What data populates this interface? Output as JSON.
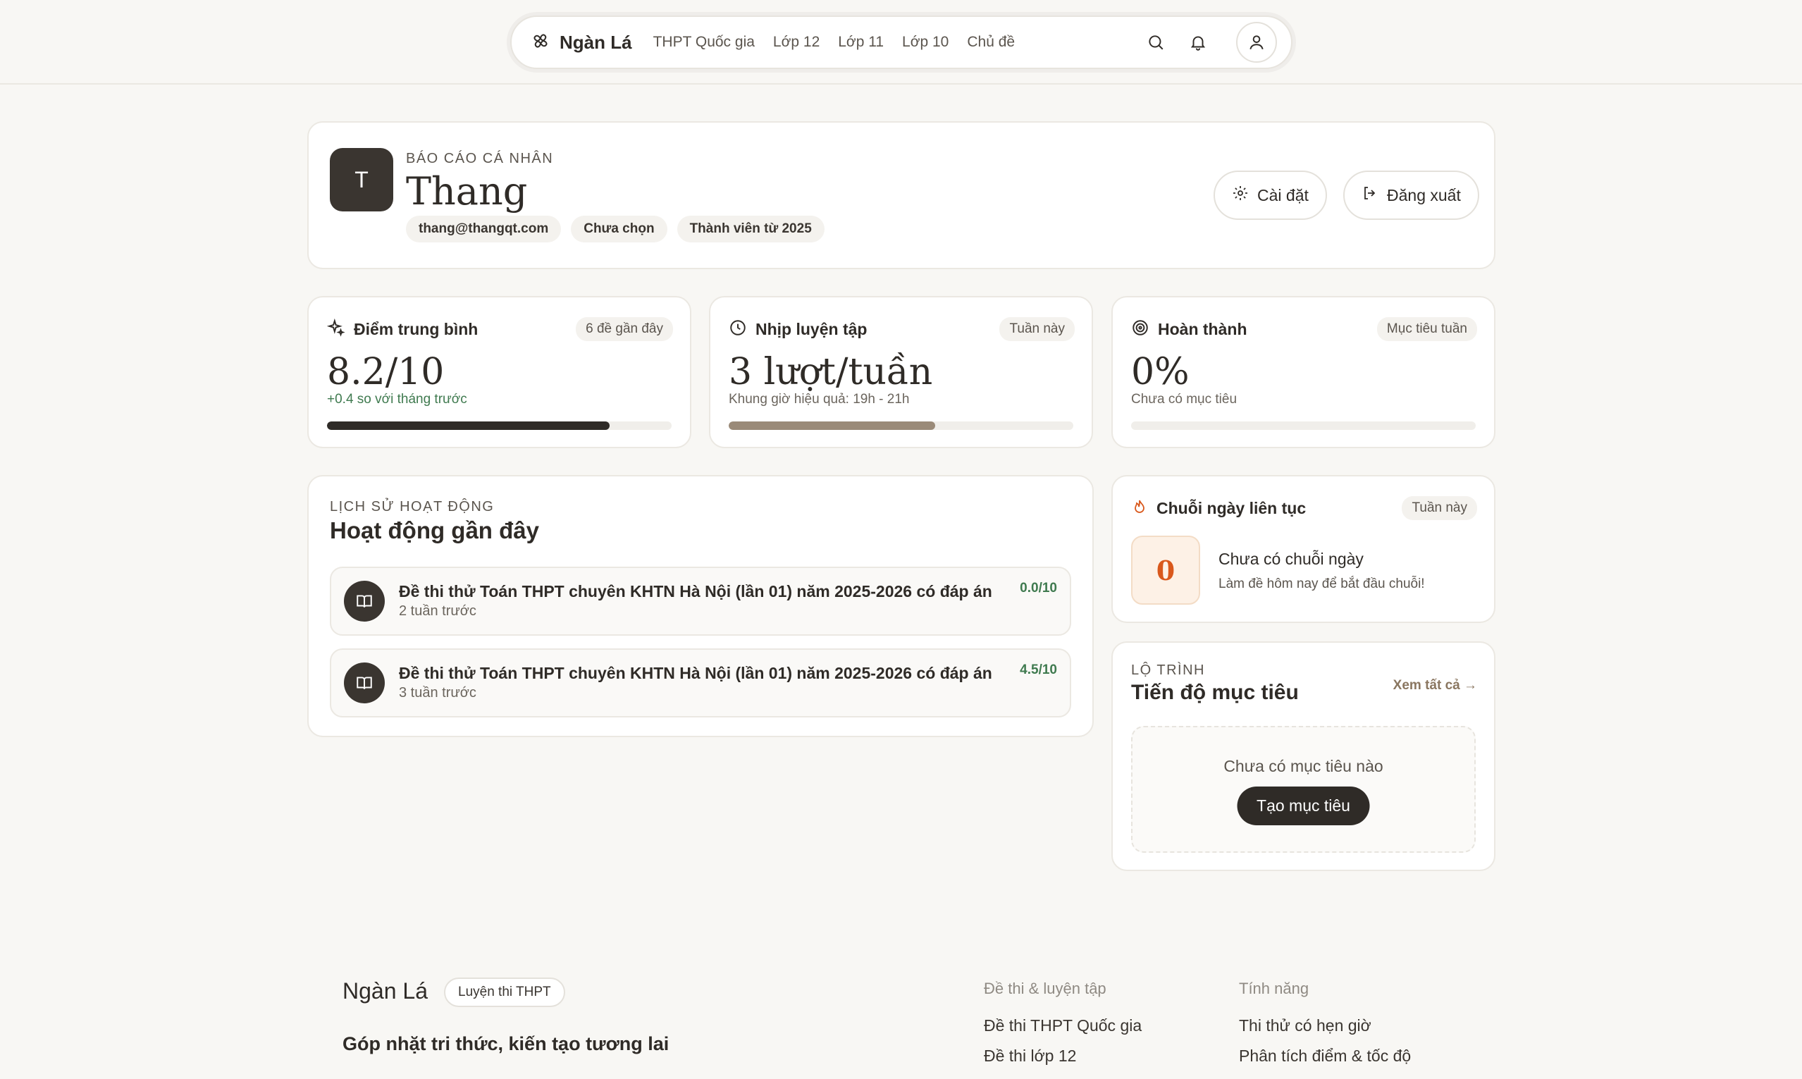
{
  "nav": {
    "brand": "Ngàn Lá",
    "links": [
      "THPT Quốc gia",
      "Lớp 12",
      "Lớp 11",
      "Lớp 10",
      "Chủ đề"
    ],
    "icons": [
      "search-icon",
      "bell-icon",
      "user-icon"
    ]
  },
  "profile": {
    "eyebrow": "BÁO CÁO CÁ NHÂN",
    "initial": "T",
    "name": "Thang",
    "chips": [
      "thang@thangqt.com",
      "Chưa chọn",
      "Thành viên từ 2025"
    ],
    "settings_label": "Cài đặt",
    "logout_label": "Đăng xuất"
  },
  "stats": [
    {
      "title": "Điểm trung bình",
      "badge": "6 đề gần đây",
      "value": "8.2/10",
      "sub": "+0.4 so với tháng trước",
      "progress": 0.82,
      "bar_color": "#2f2b27",
      "icon": "sparkle-icon"
    },
    {
      "title": "Nhịp luyện tập",
      "badge": "Tuần này",
      "value": "3 lượt/tuần",
      "sub": "Khung giờ hiệu quả: 19h - 21h",
      "progress": 0.6,
      "bar_color": "#9a8a78",
      "icon": "clock-icon"
    },
    {
      "title": "Hoàn thành",
      "badge": "Mục tiêu tuần",
      "value": "0%",
      "sub": "Chưa có mục tiêu",
      "progress": 0,
      "bar_color": "#2f2b27",
      "icon": "target-icon"
    }
  ],
  "history": {
    "eyebrow": "LỊCH SỬ HOẠT ĐỘNG",
    "title": "Hoạt động gần đây",
    "items": [
      {
        "title": "Đề thi thử Toán THPT chuyên KHTN Hà Nội (lần 01) năm 2025-2026 có đáp án",
        "time": "2 tuần trước",
        "score": "0.0/10"
      },
      {
        "title": "Đề thi thử Toán THPT chuyên KHTN Hà Nội (lần 01) năm 2025-2026 có đáp án",
        "time": "3 tuần trước",
        "score": "4.5/10"
      }
    ]
  },
  "streak": {
    "title": "Chuỗi ngày liên tục",
    "badge": "Tuần này",
    "count": "0",
    "status": "Chưa có chuỗi ngày",
    "hint": "Làm đề hôm nay để bắt đầu chuỗi!"
  },
  "goals": {
    "eyebrow": "LỘ TRÌNH",
    "title": "Tiến độ mục tiêu",
    "see_all": "Xem tất cả →",
    "empty_text": "Chưa có mục tiêu nào",
    "create_label": "Tạo mục tiêu"
  },
  "footer": {
    "brand": "Ngàn Lá",
    "tag": "Luyện thi THPT",
    "slogan": "Góp nhặt tri thức, kiến tạo tương lai",
    "columns": [
      {
        "heading": "Đề thi & luyện tập",
        "links": [
          "Đề thi THPT Quốc gia",
          "Đề thi lớp 12"
        ]
      },
      {
        "heading": "Tính năng",
        "links": [
          "Thi thử có hẹn giờ",
          "Phân tích điểm & tốc độ"
        ]
      }
    ]
  },
  "colors": {
    "accent_dark": "#2f2b27",
    "positive": "#3f7a4f",
    "streak_orange": "#d9581c",
    "link_brown": "#8a7660"
  }
}
